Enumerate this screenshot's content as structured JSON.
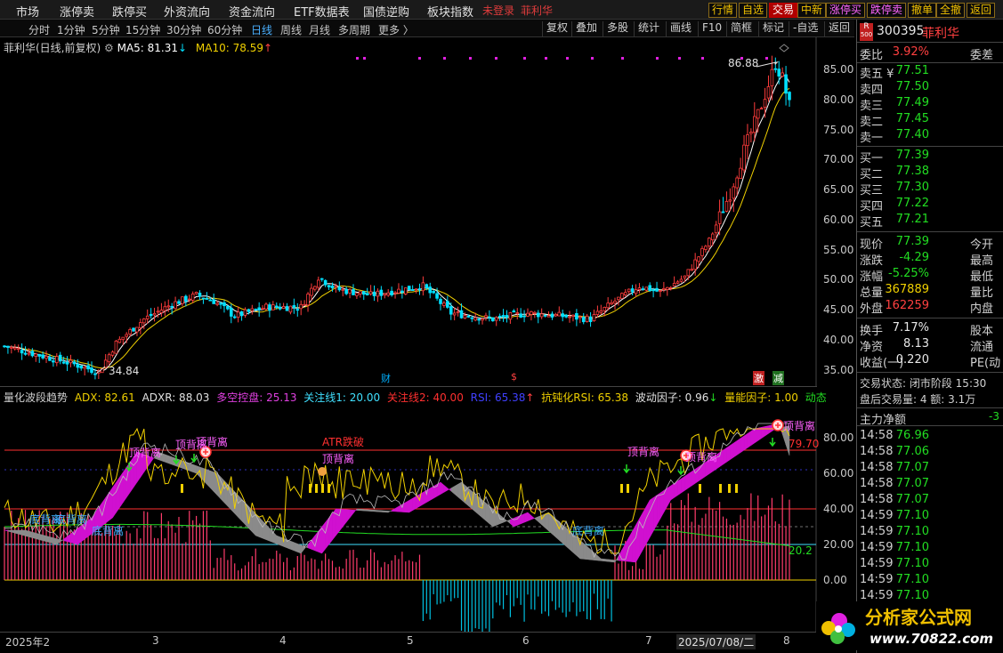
{
  "menu": {
    "items": [
      "市场",
      "涨停卖",
      "跌停买",
      "外资流向",
      "资金流向",
      "ETF数据表",
      "国债逆购",
      "板块指数"
    ],
    "login": "未登录",
    "stock_name": "菲利华",
    "buttons": [
      "行情",
      "自选",
      "交易",
      "中新",
      "涨停买",
      "跌停卖",
      "撤单",
      "全撤",
      "返回"
    ]
  },
  "periods": {
    "items": [
      "分时",
      "1分钟",
      "5分钟",
      "15分钟",
      "30分钟",
      "60分钟",
      "日线",
      "周线",
      "月线",
      "多周期",
      "更多 〉"
    ],
    "selected": "日线",
    "tools": [
      "复权",
      "叠加",
      "多股",
      "统计",
      "画线",
      "F10",
      "简框",
      "标记",
      "-自选",
      "返回"
    ]
  },
  "main_chart": {
    "title": "菲利华(日线,前复权)",
    "ma5": "MA5: 81.31",
    "ma5_arrow": "↓",
    "ma10": "MA10: 78.59",
    "ma10_arrow": "↑",
    "high_label": "86.88",
    "low_label": "34.84",
    "y_ticks": [
      "85.00",
      "80.00",
      "75.00",
      "70.00",
      "65.00",
      "60.00",
      "55.00",
      "50.00",
      "45.00",
      "40.00",
      "35.00"
    ],
    "markers": {
      "cai": "财",
      "dollar": "$",
      "ji": "激",
      "jian": "减"
    }
  },
  "indicator": {
    "name": "量化波段趋势",
    "adx": "ADX: 82.61",
    "adxr": "ADXR: 88.03",
    "duokong": "多空控盘: 25.13",
    "line1": "关注线1: 20.00",
    "line2": "关注线2: 40.00",
    "rsi": "RSI: 65.38",
    "rsi_arrow": "↑",
    "kdrsi": "抗钝化RSI: 65.38",
    "bodong": "波动因子: 0.96",
    "bodong_arrow": "↓",
    "liangneng": "量能因子: 1.00",
    "dongtai": "动态",
    "y_ticks": [
      "80.00",
      "60.00",
      "40.00",
      "20.00",
      "0.00"
    ],
    "right_values": {
      "v1": "79.70",
      "v2": "20.2"
    },
    "labels": {
      "top1": "顶背离",
      "top2": "顶背离",
      "top3": "顶背离",
      "top4": "顶背离",
      "top5": "顶背离",
      "top6": "顶背离",
      "top7": "顶背离",
      "bottom1": "底背离",
      "bottom2": "底背离",
      "bottom3": "底背离",
      "bottom4": "底背离",
      "atr": "ATR跌破"
    }
  },
  "x_axis": [
    "2025年2",
    "3",
    "4",
    "5",
    "6",
    "7",
    "2025/07/08/二",
    "8"
  ],
  "quote": {
    "badge": "R",
    "badge_sub": "500",
    "code": "300395",
    "name": "菲利华",
    "weibi_label": "委比",
    "weibi": "3.92%",
    "weicha_label": "委差",
    "sell": [
      {
        "label": "卖五 ¥",
        "price": "77.51"
      },
      {
        "label": "卖四",
        "price": "77.50"
      },
      {
        "label": "卖三",
        "price": "77.49"
      },
      {
        "label": "卖二",
        "price": "77.45"
      },
      {
        "label": "卖一",
        "price": "77.40"
      }
    ],
    "buy": [
      {
        "label": "买一",
        "price": "77.39"
      },
      {
        "label": "买二",
        "price": "77.38"
      },
      {
        "label": "买三",
        "price": "77.30"
      },
      {
        "label": "买四",
        "price": "77.22"
      },
      {
        "label": "买五",
        "price": "77.21"
      }
    ],
    "stats": [
      {
        "label": "现价",
        "value": "77.39",
        "label2": "今开",
        "color": "green"
      },
      {
        "label": "涨跌",
        "value": "-4.29",
        "label2": "最高",
        "color": "green"
      },
      {
        "label": "涨幅",
        "value": "-5.25%",
        "label2": "最低",
        "color": "green"
      },
      {
        "label": "总量",
        "value": "367889",
        "label2": "量比",
        "color": "yellow"
      },
      {
        "label": "外盘",
        "value": "162259",
        "label2": "内盘",
        "color": "red"
      }
    ],
    "stats2": [
      {
        "label": "换手",
        "value": "7.17%",
        "label2": "股本"
      },
      {
        "label": "净资",
        "value": "8.13",
        "label2": "流通"
      },
      {
        "label": "收益(一)",
        "value": "0.220",
        "label2": "PE(动"
      }
    ],
    "status": "交易状态: 闭市阶段 15:30",
    "after_hours": "盘后交易量: 4  额: 3.1万",
    "net_flow_label": "主力净额",
    "net_flow_value": "-3",
    "ticks": [
      {
        "time": "14:58",
        "price": "76.96"
      },
      {
        "time": "14:58",
        "price": "77.06"
      },
      {
        "time": "14:58",
        "price": "77.07"
      },
      {
        "time": "14:58",
        "price": "77.07"
      },
      {
        "time": "14:58",
        "price": "77.07"
      },
      {
        "time": "14:59",
        "price": "77.10"
      },
      {
        "time": "14:59",
        "price": "77.10"
      },
      {
        "time": "14:59",
        "price": "77.10"
      },
      {
        "time": "14:59",
        "price": "77.10"
      },
      {
        "time": "14:59",
        "price": "77.10"
      },
      {
        "time": "14:59",
        "price": "77.10"
      }
    ]
  },
  "watermark": {
    "title": "分析家公式网",
    "url": "www.70822.com"
  },
  "colors": {
    "up": "#ff3c3c",
    "down": "#00e0ff",
    "ma5": "#ffffff",
    "ma10": "#f0d000",
    "magenta": "#e020e0",
    "gray": "#9a9a9a"
  }
}
